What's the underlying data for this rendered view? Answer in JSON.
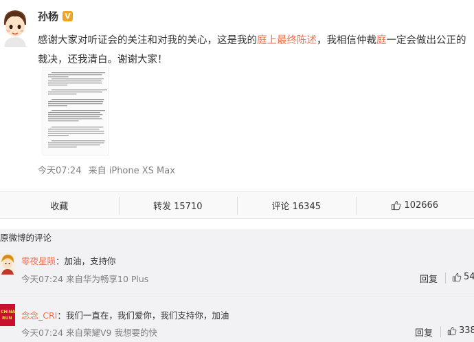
{
  "post": {
    "author": "孙杨",
    "verified_badge": "V",
    "text_before": "感谢大家对听证会的关注和对我的关心，这是我的",
    "highlight_1": "庭上最终陈述",
    "text_middle": "，我相信仲裁",
    "highlight_2": "庭",
    "text_after": "一定会做出公正的裁决，还我清白。谢谢大家！",
    "time": "今天07:24",
    "source": "来自 iPhone XS Max"
  },
  "actions": {
    "favorite_label": "收藏",
    "repost_label": "转发 15710",
    "comment_label": "评论 16345",
    "like_count": "102666"
  },
  "comments": {
    "header": "原微博的评论",
    "items": [
      {
        "user": "零夜星陨",
        "separator": "：",
        "content": "加油，支持你",
        "meta": "今天07:24 来自华为畅享10 Plus",
        "reply": "回复",
        "likes": "54"
      },
      {
        "user": "念念_CRI",
        "separator": "：",
        "content": "我们一直在，我们爱你，我们支持你，加油",
        "meta": "今天07:24 来自荣耀V9 我想要的快",
        "reply": "回复",
        "likes": "338"
      }
    ],
    "avatar_2_text": "CHINA RUN"
  },
  "icons": {
    "thumb": "thumbs-up-icon",
    "verified": "verified-v-icon"
  },
  "colors": {
    "link": "#eb7350",
    "badge": "#f3a41e",
    "meta": "#808080"
  }
}
